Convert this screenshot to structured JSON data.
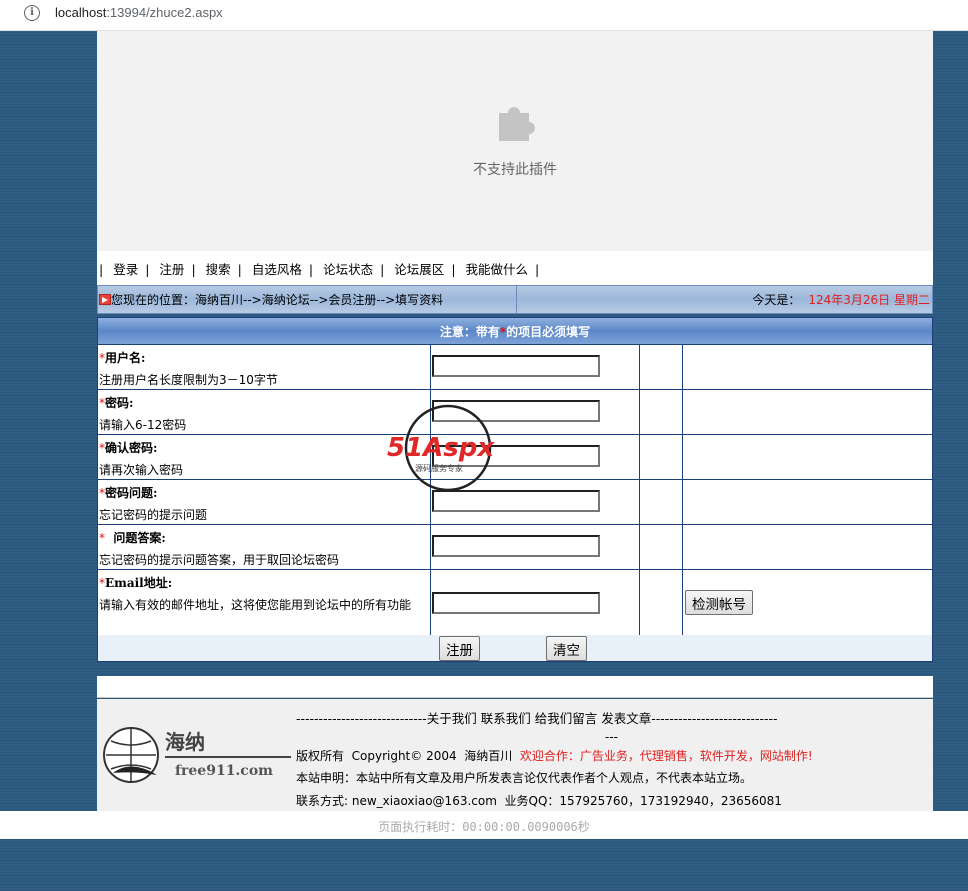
{
  "browser": {
    "url_host": "localhost",
    "url_rest": ":13994/zhuce2.aspx"
  },
  "plugin": {
    "message": "不支持此插件"
  },
  "nav": {
    "sep": "|",
    "items": [
      "登录",
      "注册",
      "搜索",
      "自选风格",
      "论坛状态",
      "论坛展区",
      "我能做什么"
    ]
  },
  "position": {
    "text": "您现在的位置：海纳百川-->海纳论坛-->会员注册-->填写资料",
    "today_label": "今天是：",
    "date": "124年3月26日 星期二"
  },
  "notice": {
    "prefix": "注意：带有",
    "star": "*",
    "suffix": "的项目必须填写"
  },
  "form": {
    "rows": [
      {
        "star": "*",
        "label": "用户名:",
        "hint": "注册用户名长度限制为3－10字节"
      },
      {
        "star": "*",
        "label": "密码:",
        "hint": "请输入6-12密码"
      },
      {
        "star": "*",
        "label": "确认密码:",
        "hint": "请再次输入密码"
      },
      {
        "star": "*",
        "label": "密码问题:",
        "hint": "忘记密码的提示问题"
      },
      {
        "star": "*",
        "label": "  问题答案:",
        "hint": "忘记密码的提示问题答案，用于取回论坛密码"
      },
      {
        "star": "*",
        "label": "Email地址:",
        "hint": "请输入有效的邮件地址，这将使您能用到论坛中的所有功能"
      }
    ],
    "check_button": "检测帐号",
    "submit_button": "注册",
    "clear_button": "清空"
  },
  "watermark": {
    "brand": "51Aspx",
    "tagline": "源码服务专家"
  },
  "footer": {
    "links_line": "-----------------------------关于我们 联系我们 给我们留言 发表文章----------------------------",
    "dash": "---",
    "copyright_prefix": "版权所有  Copyright© 2004  海纳百川",
    "copyright_red": "欢迎合作：广告业务，代理销售，软件开发，网站制作!",
    "statement": "本站申明：本站中所有文章及用户所发表言论仅代表作者个人观点，不代表本站立场。",
    "contact": "联系方式: new_xiaoxiao@163.com  业务QQ：157925760，173192940，23656081",
    "logo_cn": "海纳",
    "logo_en": "free911.com"
  },
  "exec_time": "页面执行耗时：00:00:00.0090006秒"
}
